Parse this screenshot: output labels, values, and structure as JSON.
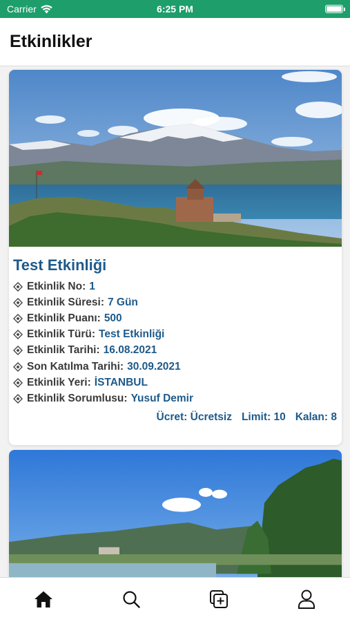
{
  "status_bar": {
    "carrier": "Carrier",
    "time": "6:25 PM"
  },
  "header": {
    "title": "Etkinlikler"
  },
  "colors": {
    "status_bar": "#1d9e6b",
    "accent": "#1e5a8a",
    "label": "#3a3a3a"
  },
  "events": [
    {
      "title": "Test Etkinliği",
      "image": "lake-mountain-church-photo",
      "fields": [
        {
          "label": "Etkinlik No:",
          "value": "1"
        },
        {
          "label": "Etkinlik Süresi:",
          "value": "7 Gün"
        },
        {
          "label": "Etkinlik Puanı:",
          "value": "500"
        },
        {
          "label": "Etkinlik Türü:",
          "value": "Test Etkinliği"
        },
        {
          "label": "Etkinlik Tarihi:",
          "value": "16.08.2021"
        },
        {
          "label": "Son Katılma Tarihi:",
          "value": "30.09.2021"
        },
        {
          "label": "Etkinlik Yeri:",
          "value": "İSTANBUL"
        },
        {
          "label": "Etkinlik Sorumlusu:",
          "value": "Yusuf Demir"
        }
      ],
      "price": "Ücret: Ücretsiz",
      "limit": "Limit: 10",
      "remaining": "Kalan: 8"
    },
    {
      "image": "forest-lake-photo"
    }
  ],
  "tab_bar": {
    "items": [
      {
        "icon": "home-icon"
      },
      {
        "icon": "search-icon"
      },
      {
        "icon": "add-event-icon"
      },
      {
        "icon": "profile-icon"
      }
    ]
  }
}
